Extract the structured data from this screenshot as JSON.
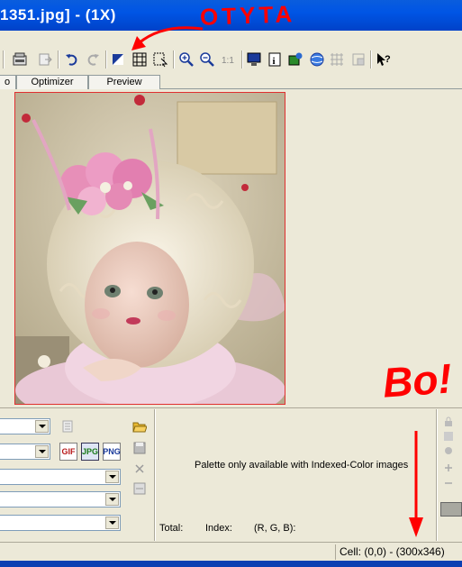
{
  "window": {
    "title": "1351.jpg] - (1X)"
  },
  "toolbar": {
    "buttons": [
      "html-icon",
      "export-icon",
      "undo-icon",
      "redo-icon",
      "crop-square-icon",
      "slice-grid-icon",
      "slice-select-icon",
      "zoom-in-icon",
      "zoom-out-icon",
      "actual-size-icon",
      "monitor-icon",
      "info-icon",
      "image-map-icon",
      "globe-icon",
      "grid-disabled-icon",
      "export-disabled-icon",
      "help-cursor-icon"
    ]
  },
  "tabs": [
    {
      "label": "o"
    },
    {
      "label": "Optimizer"
    },
    {
      "label": "Preview"
    }
  ],
  "palette": {
    "message": "Palette only available with Indexed-Color images",
    "total_label": "Total:",
    "index_label": "Index:",
    "rgb_label": "(R, G, B):"
  },
  "formats": [
    "GIF",
    "JPG",
    "PNG"
  ],
  "status": {
    "cell": "Cell: (0,0) - (300x346)"
  },
  "annotations": {
    "top": "OTYTA",
    "bottom": "Bo!"
  },
  "colors": {
    "title_bar": "#0055e5",
    "annotation": "#ff0000",
    "image_border": "#e03030"
  }
}
